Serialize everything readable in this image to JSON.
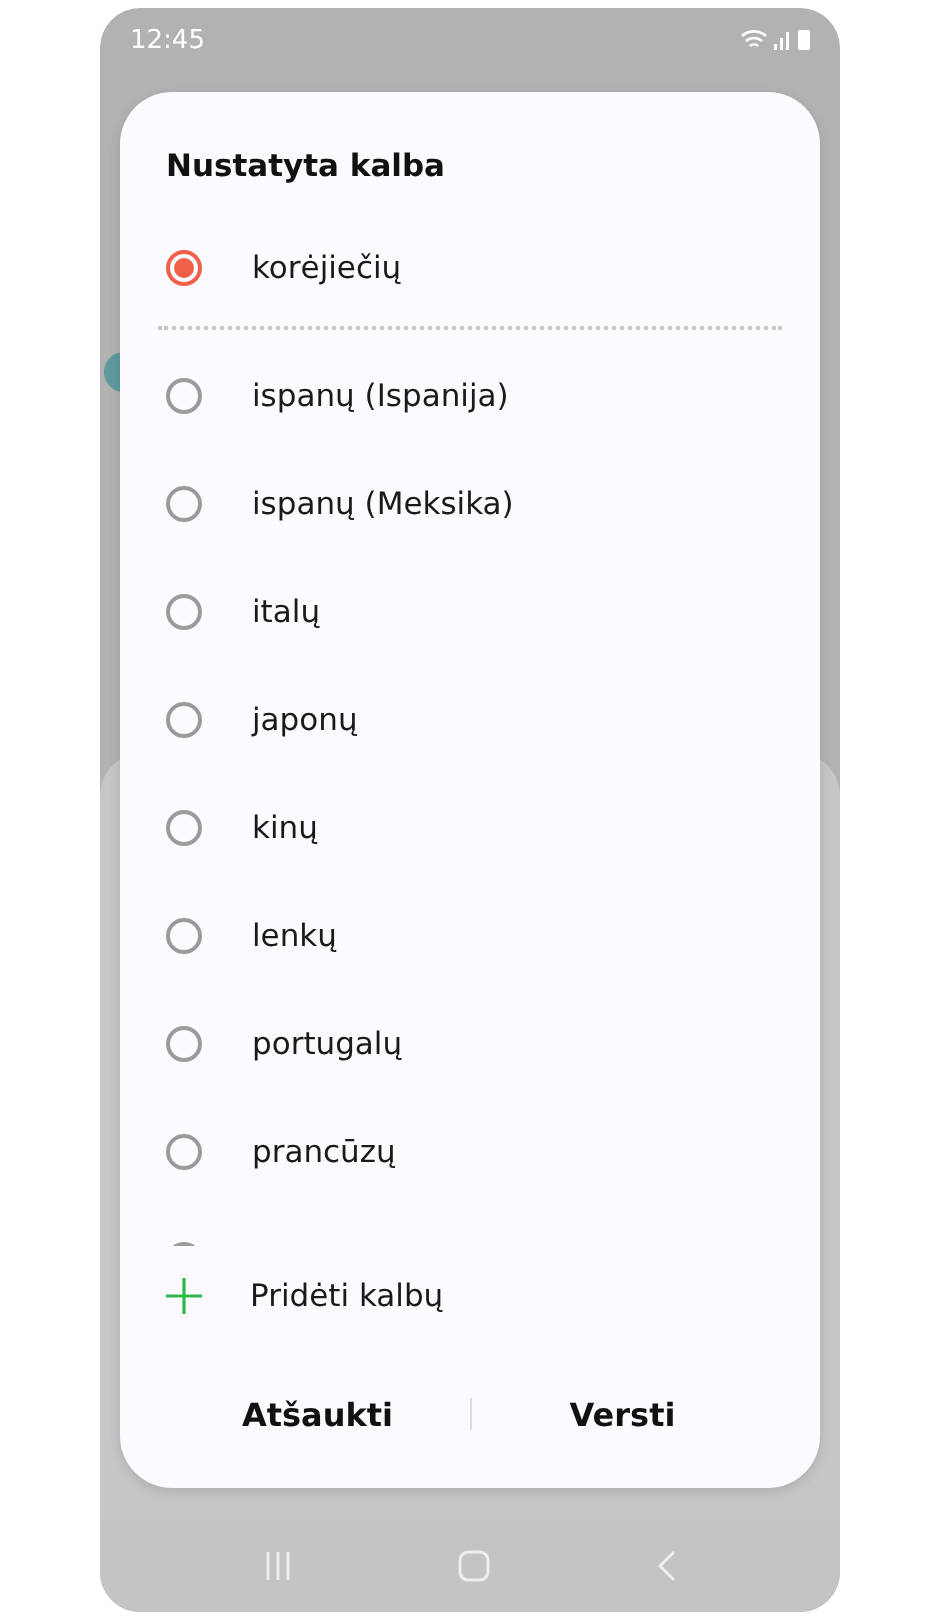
{
  "status_bar": {
    "time": "12:45"
  },
  "dialog": {
    "title": "Nustatyta kalba",
    "current": {
      "label": "korėjiečių",
      "selected": true
    },
    "languages": [
      {
        "label": "ispanų (Ispanija)",
        "selected": false
      },
      {
        "label": "ispanų (Meksika)",
        "selected": false
      },
      {
        "label": "italų",
        "selected": false
      },
      {
        "label": "japonų",
        "selected": false
      },
      {
        "label": "kinų",
        "selected": false
      },
      {
        "label": "lenkų",
        "selected": false
      },
      {
        "label": "portugalų",
        "selected": false
      },
      {
        "label": "prancūzų",
        "selected": false
      },
      {
        "selected": false
      }
    ],
    "add_language": "Pridėti kalbų",
    "buttons": [
      "Atšaukti",
      "Versti"
    ]
  }
}
